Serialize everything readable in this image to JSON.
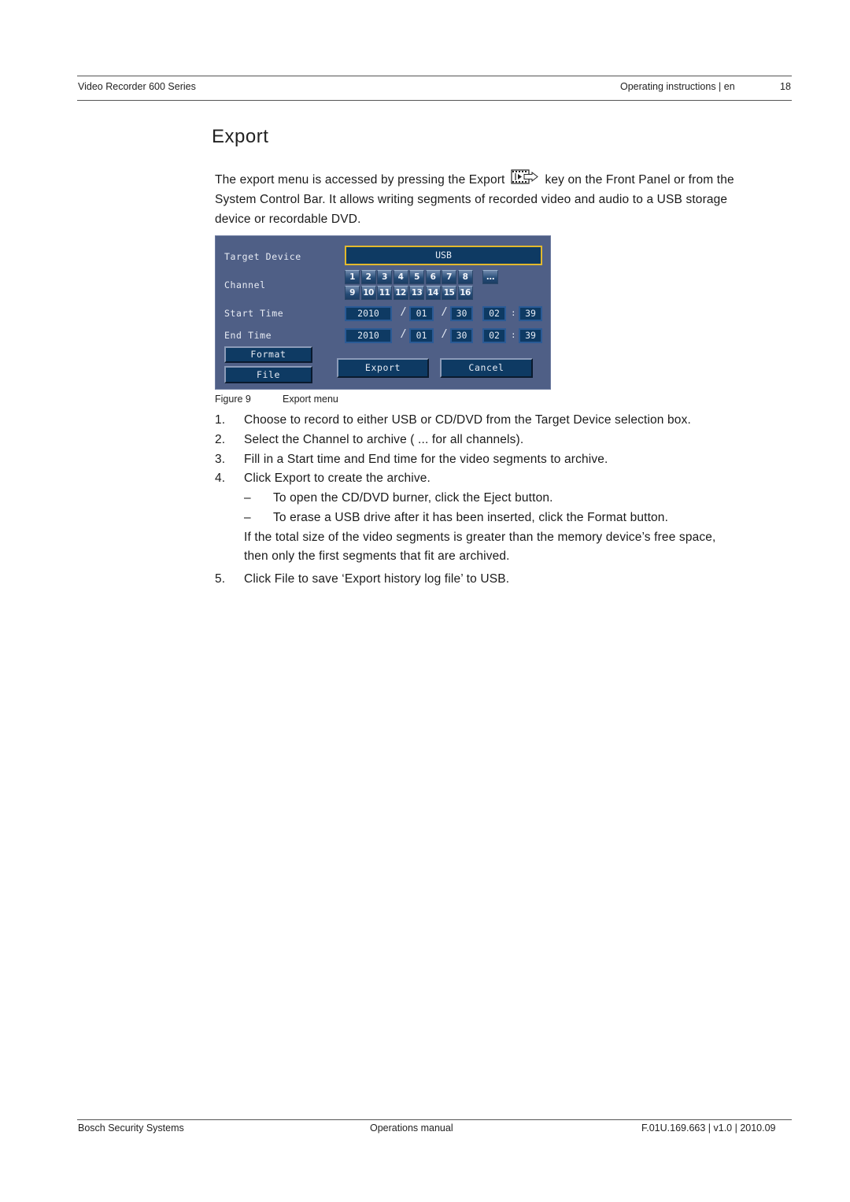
{
  "header": {
    "left": "Video Recorder 600 Series",
    "right": "Operating instructions | en",
    "page_number": "18"
  },
  "title": "Export",
  "intro": {
    "before_icon": "The export menu is accessed by pressing the Export",
    "icon": "export-key-icon",
    "after_icon": "key on the Front Panel or from the",
    "line2": "System Control Bar. It allows writing segments of recorded video and audio to a USB storage",
    "line3": "device or recordable DVD."
  },
  "dialog": {
    "colors": {
      "background": "#4f5f86",
      "field": "#0e3a63",
      "highlight": "#e3b92d"
    },
    "labels": {
      "target_device": "Target Device",
      "channel": "Channel",
      "start_time": "Start Time",
      "end_time": "End Time"
    },
    "target_device_value": "USB",
    "channels_row1": [
      "1",
      "2",
      "3",
      "4",
      "5",
      "6",
      "7",
      "8"
    ],
    "channels_row2": [
      "9",
      "10",
      "11",
      "12",
      "13",
      "14",
      "15",
      "16"
    ],
    "all_channels_label": "...",
    "start": {
      "year": "2010",
      "month": "01",
      "day": "30",
      "hour": "02",
      "minute": "39"
    },
    "end": {
      "year": "2010",
      "month": "01",
      "day": "30",
      "hour": "02",
      "minute": "39"
    },
    "separators": {
      "date": "/",
      "time": ":"
    },
    "buttons": {
      "format": "Format",
      "file": "File",
      "export": "Export",
      "cancel": "Cancel"
    }
  },
  "caption": {
    "label": "Figure 9",
    "text": "Export menu"
  },
  "steps": [
    {
      "num": "1.",
      "text": "Choose to record to either USB or CD/DVD from the Target Device selection box."
    },
    {
      "num": "2.",
      "text": "Select the Channel to archive ( ... for all channels)."
    },
    {
      "num": "3.",
      "text": "Fill in a Start time and End time for the video segments to archive."
    },
    {
      "num": "4.",
      "text": "Click Export to create the archive."
    },
    {
      "num": "5.",
      "text": "Click File to save ‘Export history log file’ to USB."
    }
  ],
  "sub_items": [
    {
      "dash": "–",
      "text": "To open the CD/DVD burner, click the Eject button."
    },
    {
      "dash": "–",
      "text": "To erase a USB drive after it has been inserted, click the Format button."
    }
  ],
  "note": {
    "line1": "If the total size of the video segments is greater than the memory device’s free space,",
    "line2": "then only the first segments that fit are archived."
  },
  "footer": {
    "left": "Bosch Security Systems",
    "center": "Operations manual",
    "right": "F.01U.169.663 | v1.0 | 2010.09"
  }
}
